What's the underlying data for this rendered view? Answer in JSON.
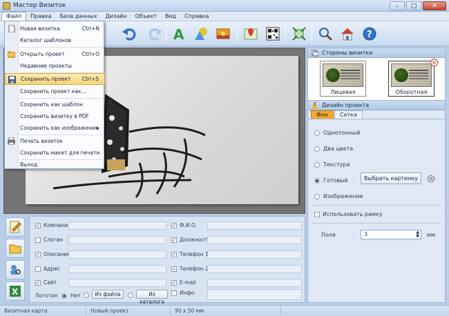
{
  "window": {
    "title": "Мастер Визиток",
    "minimize": "–",
    "maximize": "□",
    "close": "✕"
  },
  "menubar": [
    "Файл",
    "Правка",
    "База данных",
    "Дизайн",
    "Объект",
    "Вид",
    "Справка"
  ],
  "file_menu": {
    "items": [
      {
        "label": "Новая визитка",
        "shortcut": "Ctrl+N",
        "icon": "new-document-icon"
      },
      {
        "label": "Каталог шаблонов",
        "shortcut": ""
      },
      {
        "label": "Открыть проект",
        "shortcut": "Ctrl+O",
        "icon": "open-folder-icon"
      },
      {
        "label": "Недавние проекты",
        "shortcut": ""
      },
      {
        "label": "Сохранить проект",
        "shortcut": "Ctrl+S",
        "icon": "save-disk-icon",
        "highlighted": true
      },
      {
        "label": "Сохранить проект как...",
        "shortcut": ""
      },
      {
        "label": "Сохранить как шаблон",
        "shortcut": ""
      },
      {
        "label": "Сохранить визитку в PDF",
        "shortcut": ""
      },
      {
        "label": "Сохранить как изображение",
        "shortcut": "",
        "submenu": "▸"
      },
      {
        "label": "Печать визиток",
        "shortcut": "",
        "icon": "printer-icon"
      },
      {
        "label": "Сохранить макет для печати",
        "shortcut": ""
      },
      {
        "label": "Выход",
        "shortcut": ""
      }
    ]
  },
  "right_panel": {
    "sides_title": "Стороны визитки",
    "front_label": "Лицевая",
    "back_label": "Оборотная",
    "design_title": "Дизайн проекта",
    "tabs": [
      "Фон",
      "Сетка"
    ],
    "bg_options": [
      "Однотонный",
      "Два цвета",
      "Текстура",
      "Готовый",
      "Изображение"
    ],
    "choose_picture": "Выбрать картинку",
    "use_frame": "Использовать рамку",
    "margins_label": "Поля",
    "margins_value": "3",
    "margins_unit": "мм"
  },
  "fields": {
    "left": [
      {
        "label": "Компания",
        "checked": true
      },
      {
        "label": "Слоган",
        "checked": false
      },
      {
        "label": "Описание",
        "checked": true
      },
      {
        "label": "Адрес",
        "checked": false
      },
      {
        "label": "Сайт",
        "checked": true
      }
    ],
    "right": [
      {
        "label": "Ф.И.О.",
        "checked": true
      },
      {
        "label": "Должность",
        "checked": true
      },
      {
        "label": "Телефон 1",
        "checked": true
      },
      {
        "label": "Телефон 2",
        "checked": true
      },
      {
        "label": "E-mail",
        "checked": true
      },
      {
        "label": "Инфо",
        "checked": false
      }
    ],
    "logo_label": "Логотип",
    "logo_none": "Нет",
    "logo_from_file": "Из файла",
    "logo_from_catalog": "Из каталога"
  },
  "status": [
    "Визитная карта",
    "Новый проект",
    "90 x 50 мм"
  ]
}
